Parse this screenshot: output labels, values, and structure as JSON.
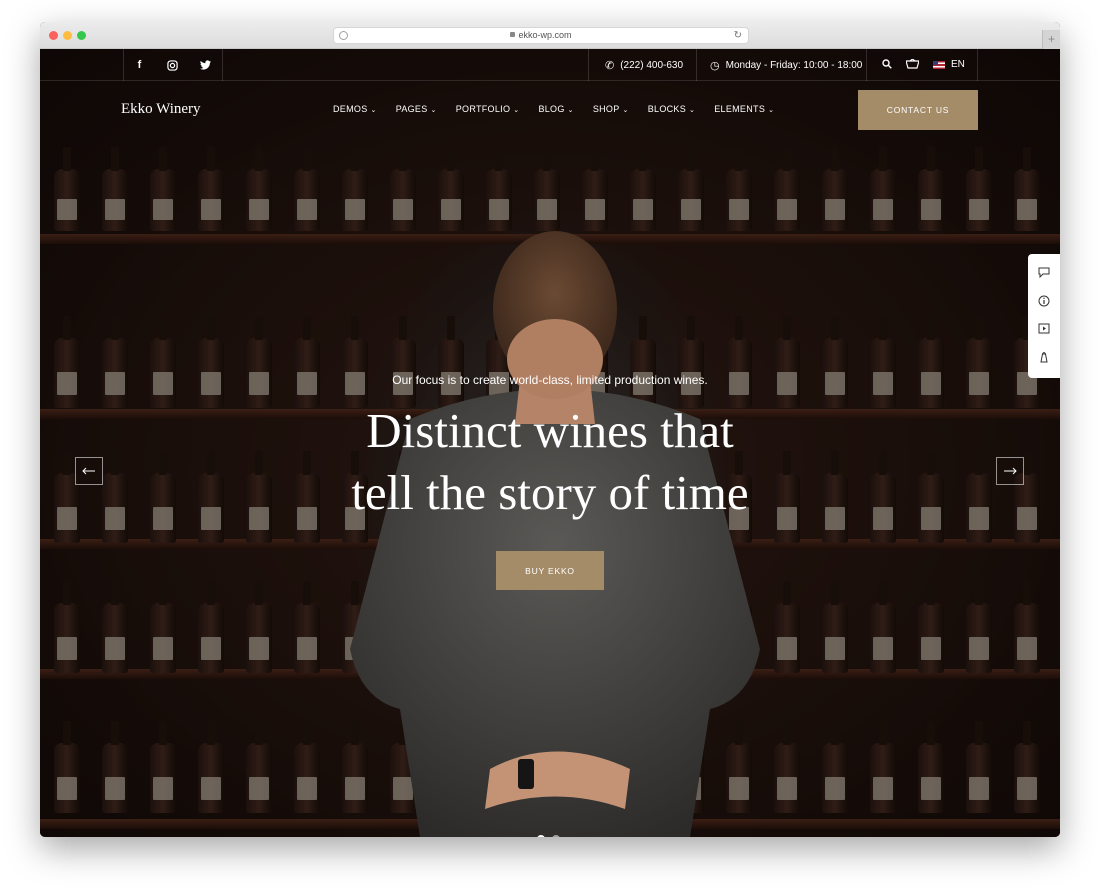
{
  "browser": {
    "url": "ekko-wp.com"
  },
  "topbar": {
    "social": [
      {
        "name": "facebook-icon",
        "glyph": "f"
      },
      {
        "name": "instagram-icon",
        "glyph": "◎"
      },
      {
        "name": "twitter-icon",
        "glyph": "🐦"
      }
    ],
    "phone": "(222) 400-630",
    "hours": "Monday - Friday: 10:00 - 18:00",
    "language": "EN"
  },
  "nav": {
    "logo": "Ekko Winery",
    "items": [
      "DEMOS",
      "PAGES",
      "PORTFOLIO",
      "BLOG",
      "SHOP",
      "BLOCKS",
      "ELEMENTS"
    ],
    "contact_label": "CONTACT US"
  },
  "hero": {
    "tagline": "Our focus is to create world-class, limited production wines.",
    "headline_line1": "Distinct wines that",
    "headline_line2": "tell the story of time",
    "cta_label": "BUY EKKO"
  },
  "colors": {
    "accent": "#a48c68",
    "background_dark": "#1a1210"
  }
}
